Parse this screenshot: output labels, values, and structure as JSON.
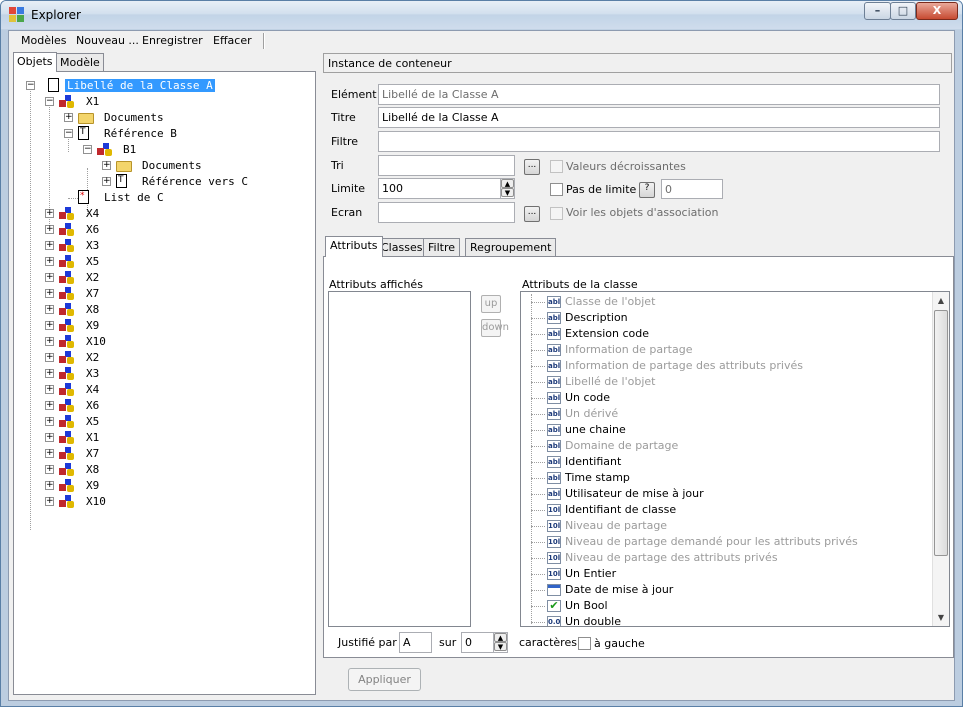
{
  "window": {
    "title": "Explorer",
    "minimize_label": "–",
    "maximize_label": "□",
    "close_label": "X"
  },
  "menu": {
    "items": [
      "Modèles",
      "Nouveau ...",
      "Enregistrer",
      "Effacer"
    ]
  },
  "left_tabs": [
    "Objets",
    "Modèle"
  ],
  "tree": {
    "root": "Libellé de la Classe A",
    "x1": "X1",
    "documents": "Documents",
    "reference_b": "Référence B",
    "b1": "B1",
    "b1_documents": "Documents",
    "reference_c": "Référence vers C",
    "list_c": "List de C",
    "siblings": [
      "X4",
      "X6",
      "X3",
      "X5",
      "X2",
      "X7",
      "X8",
      "X9",
      "X10",
      "X2",
      "X3",
      "X4",
      "X6",
      "X5",
      "X1",
      "X7",
      "X8",
      "X9",
      "X10"
    ]
  },
  "form": {
    "header": "Instance de conteneur",
    "element_label": "Elément",
    "element_value": "Libellé de la Classe A",
    "titre_label": "Titre",
    "titre_value": "Libellé de la Classe A",
    "filtre_label": "Filtre",
    "filtre_value": "",
    "tri_label": "Tri",
    "tri_value": "",
    "limite_label": "Limite",
    "limite_value": "100",
    "ecran_label": "Ecran",
    "ecran_value": "",
    "dots_label": "...",
    "valeurs_decroissantes": "Valeurs décroissantes",
    "pas_de_limite": "Pas de limite",
    "help_label": "?",
    "pas_de_limite_value": "0",
    "voir_association": "Voir les objets d'association"
  },
  "bottom_tabs": [
    "Attributs",
    "Classes",
    "Filtre",
    "Regroupement"
  ],
  "attributes": {
    "affiches_label": "Attributs affichés",
    "classe_label": "Attributs de la classe",
    "up_label": "up",
    "down_label": "down",
    "items": [
      {
        "icon": "abl",
        "label": "Classe de l'objet",
        "enabled": false
      },
      {
        "icon": "abl",
        "label": "Description",
        "enabled": true
      },
      {
        "icon": "abl",
        "label": "Extension code",
        "enabled": true
      },
      {
        "icon": "abl",
        "label": "Information de partage",
        "enabled": false
      },
      {
        "icon": "abl",
        "label": "Information de partage des attributs privés",
        "enabled": false
      },
      {
        "icon": "abl",
        "label": "Libellé de l'objet",
        "enabled": false
      },
      {
        "icon": "abl",
        "label": "Un code",
        "enabled": true
      },
      {
        "icon": "abl",
        "label": "Un dérivé",
        "enabled": false
      },
      {
        "icon": "abl",
        "label": "une chaine",
        "enabled": true
      },
      {
        "icon": "abl",
        "label": "Domaine de partage",
        "enabled": false
      },
      {
        "icon": "abl",
        "label": "Identifiant",
        "enabled": true
      },
      {
        "icon": "abl",
        "label": "Time stamp",
        "enabled": true
      },
      {
        "icon": "abl",
        "label": "Utilisateur de mise à jour",
        "enabled": true
      },
      {
        "icon": "10l",
        "label": "Identifiant de classe",
        "enabled": true
      },
      {
        "icon": "10l",
        "label": "Niveau de partage",
        "enabled": false
      },
      {
        "icon": "10l",
        "label": "Niveau de partage demandé pour les attributs privés",
        "enabled": false
      },
      {
        "icon": "10l",
        "label": "Niveau de partage des attributs privés",
        "enabled": false
      },
      {
        "icon": "10l",
        "label": "Un Entier",
        "enabled": true
      },
      {
        "icon": "cal",
        "label": "Date de mise à jour",
        "enabled": true
      },
      {
        "icon": "chk",
        "label": "Un Bool",
        "enabled": true
      },
      {
        "icon": "0.0",
        "label": "Un double",
        "enabled": true
      }
    ]
  },
  "justify": {
    "label": "Justifié par",
    "value": "A",
    "sur_label": "sur",
    "sur_value": "0",
    "caracteres_label": "caractères",
    "a_gauche_label": "à gauche"
  },
  "apply_label": "Appliquer",
  "colors": {
    "selection": "#3399ff",
    "titlebar": "#c2d4e7",
    "disabled_text": "#9b9b9b"
  }
}
